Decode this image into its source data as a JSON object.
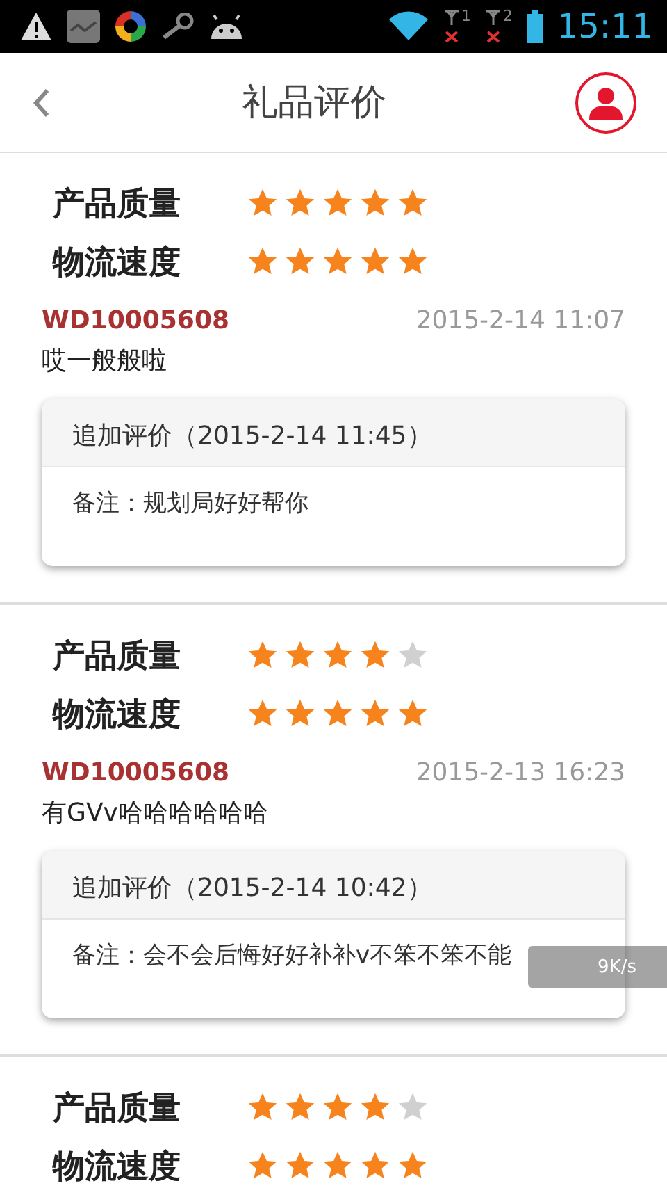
{
  "status_bar": {
    "sim_slots": [
      {
        "label": "1"
      },
      {
        "label": "2"
      }
    ],
    "time": "15:11"
  },
  "header": {
    "title": "礼品评价"
  },
  "reviews": [
    {
      "ratings": [
        {
          "label": "产品质量",
          "stars": 5
        },
        {
          "label": "物流速度",
          "stars": 5
        }
      ],
      "order_id": "WD10005608",
      "date": "2015-2-14 11:07",
      "comment": "哎一般般啦",
      "followup": {
        "title": "追加评价（2015-2-14 11:45）",
        "note": "备注：规划局好好帮你"
      }
    },
    {
      "ratings": [
        {
          "label": "产品质量",
          "stars": 4
        },
        {
          "label": "物流速度",
          "stars": 5
        }
      ],
      "order_id": "WD10005608",
      "date": "2015-2-13 16:23",
      "comment": "有GVv哈哈哈哈哈哈",
      "followup": {
        "title": "追加评价（2015-2-14 10:42）",
        "note": "备注：会不会后悔好好补补v不笨不笨不能"
      }
    },
    {
      "ratings": [
        {
          "label": "产品质量",
          "stars": 4
        },
        {
          "label": "物流速度",
          "stars": 5
        }
      ]
    }
  ],
  "speed_overlay": {
    "reading": "9K/s"
  }
}
